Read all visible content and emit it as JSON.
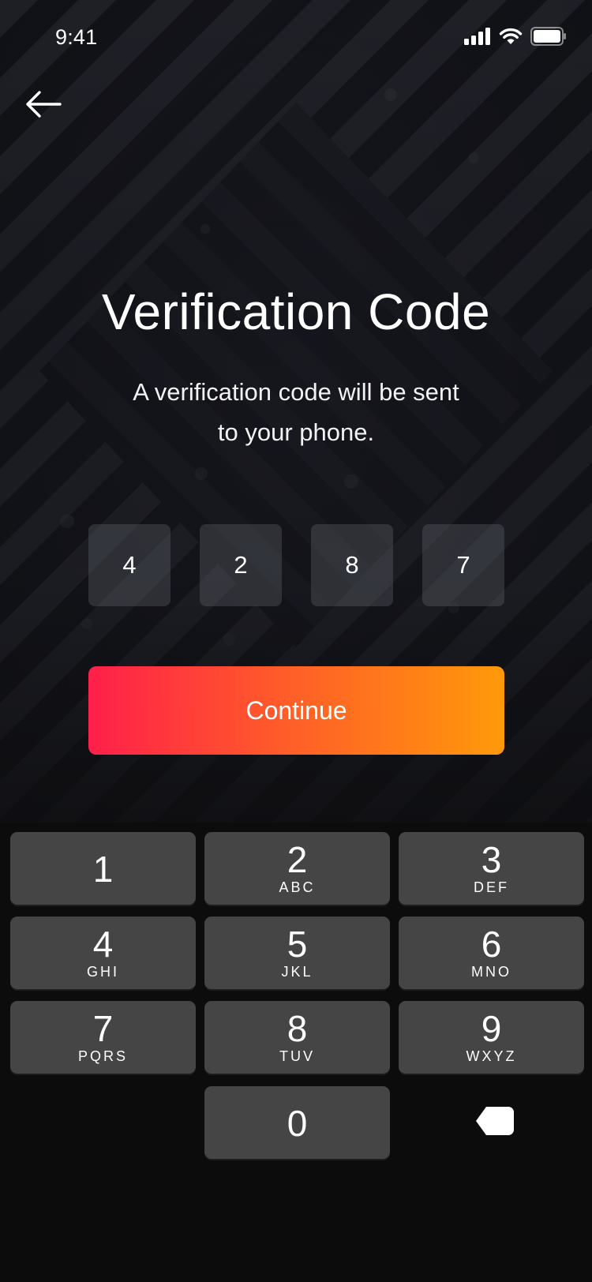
{
  "status_bar": {
    "time": "9:41",
    "icons": [
      "signal-icon",
      "wifi-icon",
      "battery-icon"
    ]
  },
  "nav": {
    "back_icon": "arrow-left-icon"
  },
  "title": "Verification Code",
  "subtitle_line1": "A verification code will be sent",
  "subtitle_line2": "to your phone.",
  "otp": [
    "4",
    "2",
    "8",
    "7"
  ],
  "continue_label": "Continue",
  "keypad": {
    "keys": [
      {
        "num": "1",
        "letters": ""
      },
      {
        "num": "2",
        "letters": "ABC"
      },
      {
        "num": "3",
        "letters": "DEF"
      },
      {
        "num": "4",
        "letters": "GHI"
      },
      {
        "num": "5",
        "letters": "JKL"
      },
      {
        "num": "6",
        "letters": "MNO"
      },
      {
        "num": "7",
        "letters": "PQRS"
      },
      {
        "num": "8",
        "letters": "TUV"
      },
      {
        "num": "9",
        "letters": "WXYZ"
      },
      {
        "num": "0",
        "letters": ""
      }
    ],
    "delete_icon": "backspace-icon"
  },
  "colors": {
    "button_gradient_start": "#ff1f4a",
    "button_gradient_end": "#ff9a0a",
    "key_background": "#454545",
    "keypad_background": "#0c0c0d"
  }
}
